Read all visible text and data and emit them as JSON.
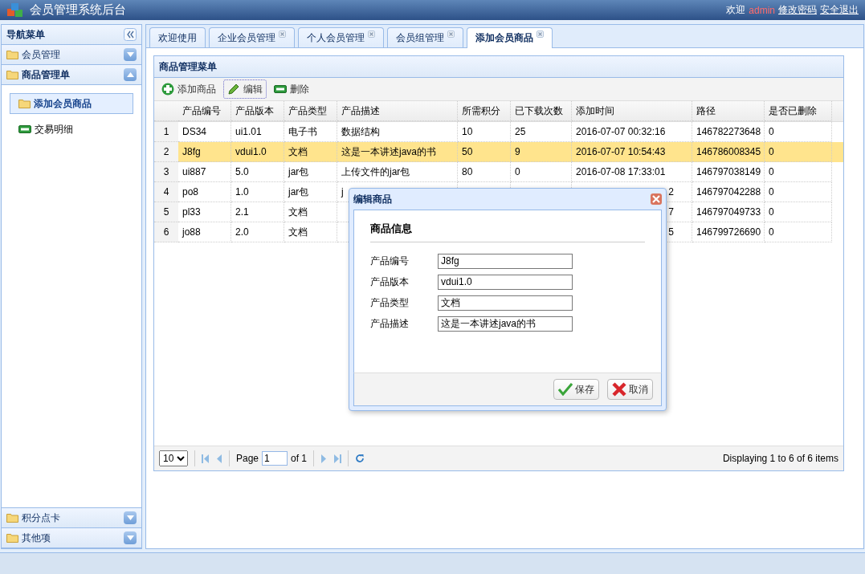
{
  "header": {
    "title": "会员管理系统后台",
    "welcome": "欢迎",
    "user": "admin",
    "links": [
      "修改密码",
      "安全退出"
    ]
  },
  "sidebar": {
    "title": "导航菜单",
    "panels": [
      {
        "label": "会员管理",
        "expanded": false
      },
      {
        "label": "商品管理单",
        "expanded": true,
        "items": [
          {
            "label": "添加会员商品",
            "selected": true,
            "kind": "folder"
          },
          {
            "label": "交易明细",
            "selected": false,
            "kind": "bar"
          }
        ]
      },
      {
        "label": "积分点卡",
        "expanded": false
      },
      {
        "label": "其他项",
        "expanded": false
      }
    ]
  },
  "tabs": [
    {
      "label": "欢迎使用",
      "selected": false,
      "closable": false
    },
    {
      "label": "企业会员管理",
      "selected": false,
      "closable": true
    },
    {
      "label": "个人会员管理",
      "selected": false,
      "closable": true
    },
    {
      "label": "会员组管理",
      "selected": false,
      "closable": true
    },
    {
      "label": "添加会员商品",
      "selected": true,
      "closable": true
    }
  ],
  "panel": {
    "title": "商品管理菜单",
    "toolbar": [
      {
        "label": "添加商品",
        "kind": "add",
        "focused": false
      },
      {
        "label": "编辑",
        "kind": "edit",
        "focused": true
      },
      {
        "label": "删除",
        "kind": "remove",
        "focused": false
      }
    ],
    "columns": [
      "产品编号",
      "产品版本",
      "产品类型",
      "产品描述",
      "所需积分",
      "已下载次数",
      "添加时间",
      "路径",
      "是否已删除"
    ],
    "rows": [
      {
        "num": "1",
        "selected": false,
        "covered": false,
        "cells": [
          "DS34",
          "ui1.01",
          "电子书",
          "数据结构",
          "10",
          "25",
          "2016-07-07 00:32:16",
          "146782273648",
          "0"
        ]
      },
      {
        "num": "2",
        "selected": true,
        "covered": false,
        "cells": [
          "J8fg",
          "vdui1.0",
          "文档",
          "这是一本讲述java的书",
          "50",
          "9",
          "2016-07-07 10:54:43",
          "146786008345",
          "0"
        ]
      },
      {
        "num": "3",
        "selected": false,
        "covered": false,
        "cells": [
          "ui887",
          "5.0",
          "jar包",
          "上传文件的jar包",
          "80",
          "0",
          "2016-07-08 17:33:01",
          "146797038149",
          "0"
        ]
      },
      {
        "num": "4",
        "selected": false,
        "covered": true,
        "cells": [
          "po8",
          "1.0",
          "jar包",
          "j",
          "",
          "",
          "2",
          "146797042288",
          "0"
        ]
      },
      {
        "num": "5",
        "selected": false,
        "covered": true,
        "cells": [
          "pl33",
          "2.1",
          "文档",
          "",
          "",
          "",
          "7",
          "146797049733",
          "0"
        ]
      },
      {
        "num": "6",
        "selected": false,
        "covered": true,
        "cells": [
          "jo88",
          "2.0",
          "文档",
          "",
          "",
          "",
          "5",
          "146799726690",
          "0"
        ]
      }
    ],
    "pager": {
      "page_size": "10",
      "page_label": "Page",
      "page": "1",
      "of": "of 1",
      "info": "Displaying 1 to 6 of 6 items"
    }
  },
  "dialog": {
    "title": "编辑商品",
    "section": "商品信息",
    "fields": [
      {
        "label": "产品编号",
        "value": "J8fg"
      },
      {
        "label": "产品版本",
        "value": "vdui1.0"
      },
      {
        "label": "产品类型",
        "value": "文档"
      },
      {
        "label": "产品描述",
        "value": "这是一本讲述java的书"
      }
    ],
    "buttons": [
      {
        "label": "保存",
        "kind": "ok"
      },
      {
        "label": "取消",
        "kind": "cancel"
      }
    ]
  }
}
